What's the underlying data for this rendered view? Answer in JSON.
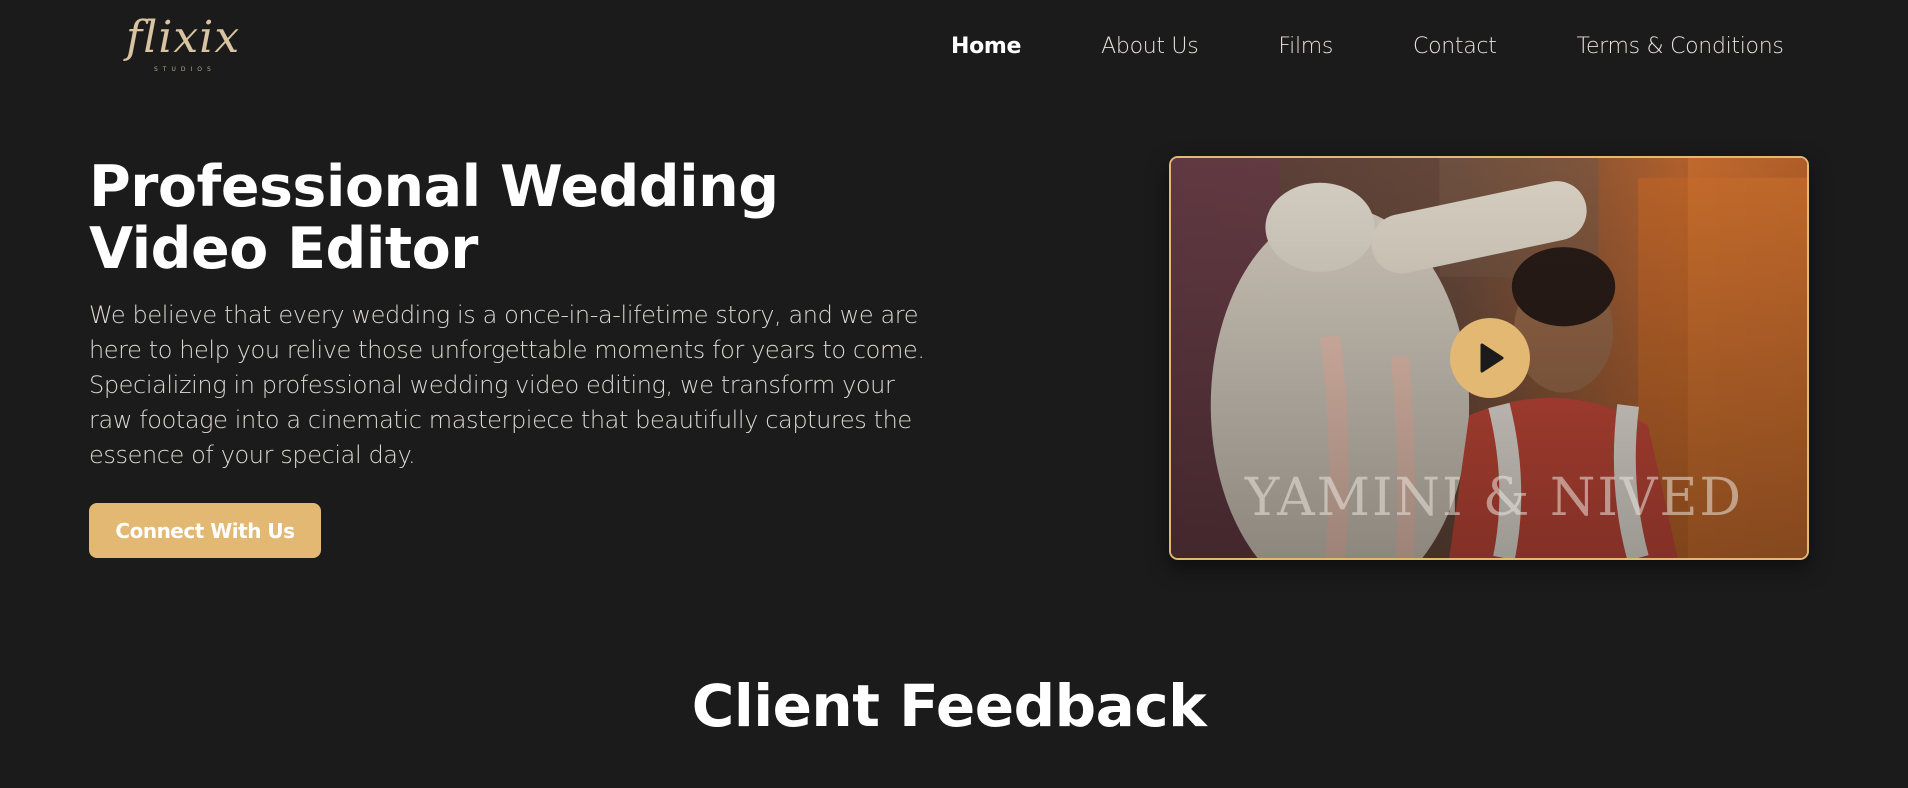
{
  "brand": {
    "logo_text": "flixix",
    "logo_subtext": "STUDIOS"
  },
  "nav": {
    "items": [
      {
        "label": "Home",
        "active": true
      },
      {
        "label": "About Us"
      },
      {
        "label": "Films"
      },
      {
        "label": "Contact"
      },
      {
        "label": "Terms & Conditions"
      }
    ]
  },
  "hero": {
    "title": "Professional Wedding Video Editor",
    "description": "We believe that every wedding is a once-in-a-lifetime story, and we are here to help you relive those unforgettable moments for years to come. Specializing in professional wedding video editing, we transform your raw footage into a cinematic masterpiece that beautifully captures the essence of your special day.",
    "cta_label": "Connect With Us"
  },
  "video": {
    "caption": "YAMINI & NIVED",
    "play_icon": "play-icon"
  },
  "feedback": {
    "title": "Client Feedback"
  },
  "colors": {
    "background": "#1b1b1b",
    "accent": "#e3b873",
    "text": "#ffffff"
  }
}
